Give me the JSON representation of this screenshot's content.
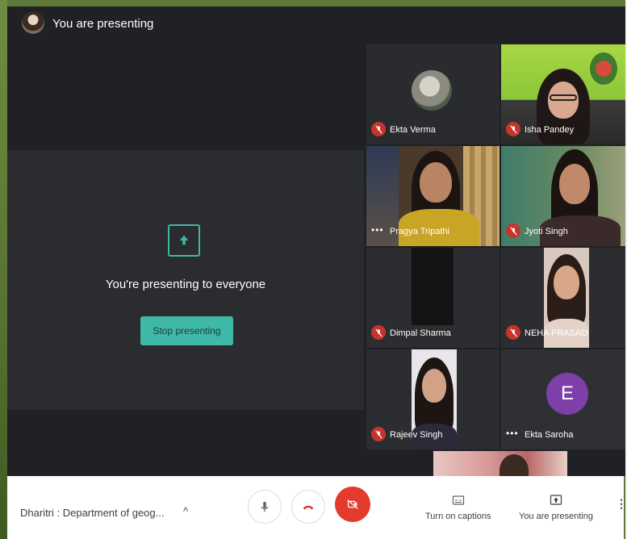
{
  "header": {
    "title": "You are presenting"
  },
  "presentation": {
    "message": "You're presenting to everyone",
    "stop_button_label": "Stop presenting"
  },
  "participants": [
    {
      "name": "Ekta Verma",
      "muted": true
    },
    {
      "name": "Isha Pandey",
      "muted": true
    },
    {
      "name": "Pragya Tripathi",
      "muted": false
    },
    {
      "name": "Jyoti Singh",
      "muted": true
    },
    {
      "name": "Dimpal Sharma",
      "muted": true
    },
    {
      "name": "NEHA PRASAD",
      "muted": true
    },
    {
      "name": "Rajeev Singh",
      "muted": true
    },
    {
      "name": "Ekta Saroha",
      "muted": false,
      "avatar_initial": "E",
      "avatar_color": "#7e3fa8"
    }
  ],
  "bottom_bar": {
    "meeting_title": "Dharitri : Department of geog...",
    "caret": "^",
    "captions_label": "Turn on captions",
    "presenting_label": "You are presenting",
    "more_label": "⋮"
  },
  "colors": {
    "accent": "#3fb8a6",
    "end_call": "#e33b2e",
    "mute_badge": "#c5352d",
    "stage_bg": "#202124"
  },
  "icons": [
    "present-up-arrow-icon",
    "mic-off-icon",
    "more-dots-icon",
    "mic-icon",
    "hang-up-icon",
    "camera-off-icon",
    "captions-icon",
    "present-screen-icon",
    "kebab-menu-icon"
  ]
}
